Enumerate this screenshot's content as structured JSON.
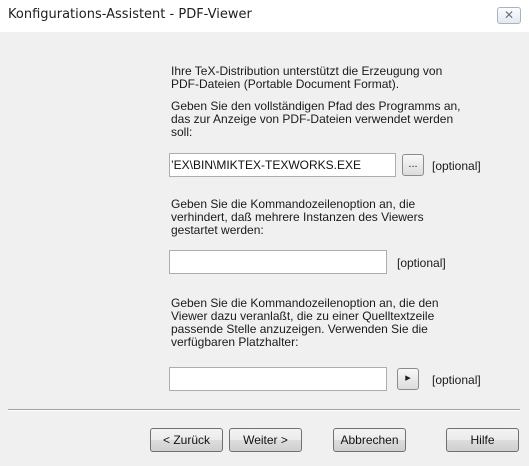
{
  "window": {
    "title": "Konfigurations-Assistent - PDF-Viewer",
    "close_symbol": "✕"
  },
  "intro": "Ihre TeX-Distribution unterstützt die Erzeugung von\nPDF-Dateien (Portable Document Format).",
  "path_section": {
    "label": "Geben Sie den vollständigen Pfad des Programms an,\ndas zur Anzeige von PDF-Dateien verwendet werden\nsoll:",
    "value": "’EX\\BIN\\MIKTEX-TEXWORKS.EXE",
    "browse_label": "...",
    "optional": "[optional]"
  },
  "instance_section": {
    "label": "Geben Sie die Kommandozeilenoption an, die\nverhindert, daß mehrere Instanzen des Viewers\ngestartet werden:",
    "value": "",
    "optional": "[optional]"
  },
  "source_section": {
    "label": "Geben Sie die Kommandozeilenoption an, die den\nViewer dazu veranlaßt, die zu einer Quelltextzeile\npassende Stelle anzuzeigen. Verwenden Sie die\nverfügbaren Platzhalter:",
    "value": "",
    "arrow_symbol": "▸",
    "optional": "[optional]"
  },
  "buttons": {
    "back": "< Zurück",
    "next": "Weiter >",
    "cancel": "Abbrechen",
    "help": "Hilfe"
  }
}
